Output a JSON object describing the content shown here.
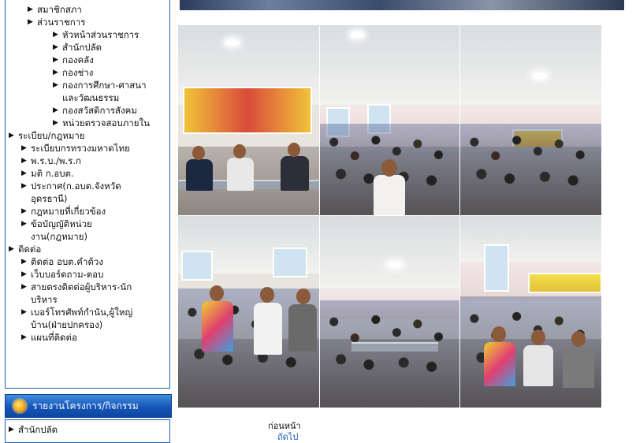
{
  "sidebar": {
    "items": [
      {
        "label": "สมาชิกสภา",
        "level": "lvl1",
        "lines": 1
      },
      {
        "label": "ส่วนราชการ",
        "level": "lvl1",
        "lines": 1
      },
      {
        "label": "หัวหน้าส่วนราชการ",
        "level": "lvl2",
        "lines": 1
      },
      {
        "label": "สำนักปลัด",
        "level": "lvl2",
        "lines": 1
      },
      {
        "label": "กองคลัง",
        "level": "lvl2",
        "lines": 1
      },
      {
        "label": "กองช่าง",
        "level": "lvl2",
        "lines": 1
      },
      {
        "label": "กองการศึกษา-ศาสนา",
        "level": "lvl2",
        "lines": 1
      },
      {
        "label": "และวัฒนธรรม",
        "level": "lvl2",
        "cont": true
      },
      {
        "label": "กองสวัสดิการสังคม",
        "level": "lvl2",
        "lines": 1
      },
      {
        "label": "หน่วยตรวจสอบภายใน",
        "level": "lvl2",
        "lines": 1
      },
      {
        "label": "ระเบียบ/กฎหมาย",
        "level": "lvl0",
        "lines": 1
      },
      {
        "label": "ระเบียบกรทรวงมหาดไทย",
        "level": "lvl1b",
        "lines": 1
      },
      {
        "label": "พ.ร.บ./พ.ร.ก",
        "level": "lvl1b",
        "lines": 1
      },
      {
        "label": "มติ ก.อบต.",
        "level": "lvl1b",
        "lines": 1
      },
      {
        "label": "ประกาศ(ก.อบต.จังหวัด",
        "level": "lvl1b",
        "lines": 1
      },
      {
        "label": "อุดรธานี)",
        "level": "lvl1b",
        "cont": true
      },
      {
        "label": "กฎหมายที่เกี่ยวข้อง",
        "level": "lvl1b",
        "lines": 1
      },
      {
        "label": "ข้อบัญญัติหน่วย",
        "level": "lvl1b",
        "lines": 1
      },
      {
        "label": "งาน(กฎหมาย)",
        "level": "lvl1b",
        "cont": true
      },
      {
        "label": "ติดต่อ",
        "level": "lvl0",
        "lines": 1
      },
      {
        "label": "ติดต่อ อบต.คำด้วง",
        "level": "lvl1b",
        "lines": 1
      },
      {
        "label": "เว็บบอร์ดถาม-ตอบ",
        "level": "lvl1b",
        "lines": 1
      },
      {
        "label": "สายตรงติดต่อผู้บริหาร-นัก",
        "level": "lvl1b",
        "lines": 1
      },
      {
        "label": "บริหาร",
        "level": "lvl1b",
        "cont": true
      },
      {
        "label": "เบอร์โทรศัพท์กำนัน,ผู้ใหญ่",
        "level": "lvl1b",
        "lines": 1
      },
      {
        "label": "บ้าน(ฝ่ายปกครอง)",
        "level": "lvl1b",
        "cont": true
      },
      {
        "label": "แผนที่ติดต่อ",
        "level": "lvl1b",
        "lines": 1
      }
    ],
    "banner_label": "รายงานโครงการ/กิจกรรม",
    "bottom_item": "สำนักปลัด"
  },
  "nav": {
    "prev_label": "ก่อนหน้า",
    "next_label": "ถัดไป"
  },
  "colors": {
    "border": "#1f5fb4",
    "banner": "#1656b8"
  }
}
